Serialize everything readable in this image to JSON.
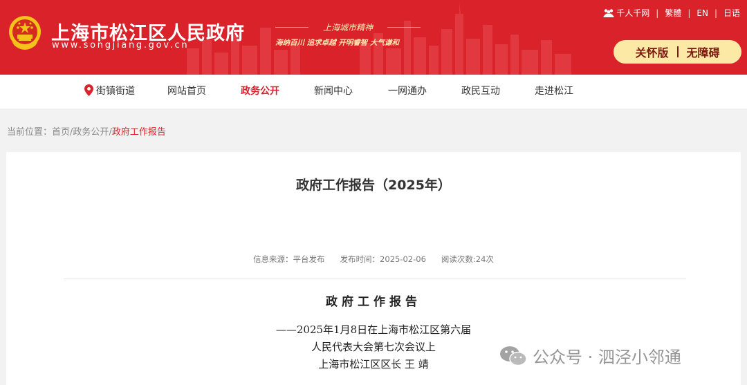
{
  "header": {
    "site_title": "上海市松江区人民政府",
    "site_url": "www.songjiang.gov.cn",
    "spirit_title": "上海城市精神",
    "spirit_motto": "海纳百川  追求卓越  开明睿智  大气谦和",
    "brand_color": "#d9222a",
    "top_links": {
      "qianren": "千人千网",
      "traditional": "繁體",
      "english": "EN",
      "japanese": "日语"
    },
    "care_version": "关怀版",
    "accessible": "无障碍"
  },
  "nav": {
    "town": "街镇街道",
    "items": [
      "网站首页",
      "政务公开",
      "新闻中心",
      "一网通办",
      "政民互动",
      "走进松江"
    ],
    "active": "政务公开"
  },
  "breadcrumb": {
    "label": "当前位置：",
    "home": "首页",
    "section": "政务公开",
    "current": "政府工作报告",
    "sep": "/"
  },
  "article": {
    "title": "政府工作报告（2025年）",
    "source": "信息来源：平台发布",
    "publish_time": "发布时间：2025-02-06",
    "views": "阅读次数:24次",
    "report_title": "政府工作报告",
    "subtitle_line1": "——2025年1月8日在上海市松江区第六届",
    "subtitle_line2": "人民代表大会第七次会议上",
    "subtitle_line3": "上海市松江区区长    王    靖"
  },
  "watermark": {
    "text": "公众号 · 泗泾小邻通"
  }
}
